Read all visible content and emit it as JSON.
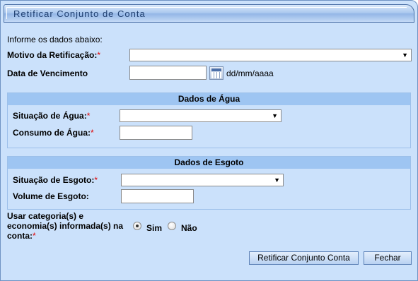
{
  "window": {
    "title": "Retificar Conjunto de Conta"
  },
  "form": {
    "intro": "Informe os dados abaixo:",
    "motivo_label": "Motivo da Retificação:",
    "motivo_value": "",
    "data_vencimento_label": "Data de Vencimento",
    "data_vencimento_value": "",
    "date_format_hint": "dd/mm/aaaa",
    "required_mark": "*"
  },
  "agua": {
    "heading": "Dados de Água",
    "situacao_label": "Situação de Água:",
    "situacao_value": "",
    "consumo_label": "Consumo de Água:",
    "consumo_value": ""
  },
  "esgoto": {
    "heading": "Dados de Esgoto",
    "situacao_label": "Situação de Esgoto:",
    "situacao_value": "",
    "volume_label": "Volume de Esgoto:",
    "volume_value": ""
  },
  "categoria": {
    "label_line1": "Usar categoria(s) e",
    "label_line2": "economia(s) informada(s) na",
    "label_line3": "conta:",
    "option_sim": "Sim",
    "option_nao": "Não",
    "selected": "Sim"
  },
  "actions": {
    "submit_label": "Retificar Conjunto Conta",
    "close_label": "Fechar"
  },
  "icons": {
    "dropdown": "chevron-down-icon",
    "calendar": "calendar-icon"
  }
}
